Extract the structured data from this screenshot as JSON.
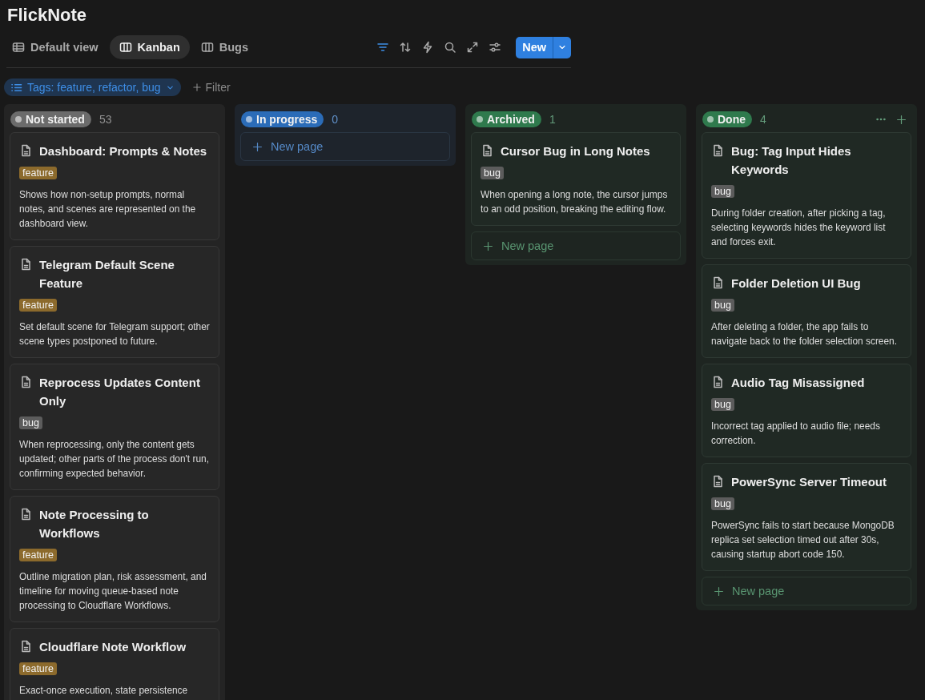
{
  "app_title": "FlickNote",
  "tabs": [
    {
      "label": "Default view",
      "kind": "table",
      "selected": false
    },
    {
      "label": "Kanban",
      "kind": "board",
      "selected": true
    },
    {
      "label": "Bugs",
      "kind": "board",
      "selected": false
    }
  ],
  "toolbar": [
    {
      "kind": "filter",
      "active": true
    },
    {
      "kind": "sort",
      "active": false
    },
    {
      "kind": "bolt",
      "active": false
    },
    {
      "kind": "search",
      "active": false
    },
    {
      "kind": "expand",
      "active": false
    },
    {
      "kind": "settings",
      "active": false
    }
  ],
  "new_button": "New",
  "filters": {
    "chip": "Tags: feature, refactor, bug",
    "add": "Filter"
  },
  "columns": [
    {
      "status": "Not started",
      "count": "53",
      "color": "#6b6b6b",
      "show_actions": false,
      "cards": [
        {
          "title": "Dashboard: Prompts & Notes",
          "tag": {
            "label": "feature",
            "color": "#8c6a2c"
          },
          "description": "Shows how non-setup prompts, normal notes, and scenes are represented on the dashboard view."
        },
        {
          "title": "Telegram Default Scene Feature",
          "tag": {
            "label": "feature",
            "color": "#8c6a2c"
          },
          "description": "Set default scene for Telegram support; other scene types postponed to future."
        },
        {
          "title": "Reprocess Updates Content Only",
          "tag": {
            "label": "bug",
            "color": "#5c5c5c"
          },
          "description": "When reprocessing, only the content gets updated; other parts of the process don't run, confirming expected behavior."
        },
        {
          "title": "Note Processing to Workflows",
          "tag": {
            "label": "feature",
            "color": "#8c6a2c"
          },
          "description": "Outline migration plan, risk assessment, and timeline for moving queue-based note processing to Cloudflare Workflows."
        },
        {
          "title": "Cloudflare Note Workflow",
          "tag": {
            "label": "feature",
            "color": "#8c6a2c"
          },
          "description": "Exact-once execution, state persistence"
        }
      ]
    },
    {
      "status": "In progress",
      "count": "0",
      "color": "#2b6cb8",
      "show_actions": false,
      "new_page": "New page"
    },
    {
      "status": "Archived",
      "count": "1",
      "color": "#2f7a4d",
      "show_actions": false,
      "new_page": "New page",
      "cards": [
        {
          "title": "Cursor Bug in Long Notes",
          "tag": {
            "label": "bug",
            "color": "#5c5c5c"
          },
          "description": "When opening a long note, the cursor jumps to an odd position, breaking the editing flow."
        }
      ]
    },
    {
      "status": "Done",
      "count": "4",
      "color": "#2f7a4d",
      "show_actions": true,
      "new_page": "New page",
      "cards": [
        {
          "title": "Bug: Tag Input Hides Keywords",
          "tag": {
            "label": "bug",
            "color": "#5c5c5c"
          },
          "description": "During folder creation, after picking a tag, selecting keywords hides the keyword list and forces exit."
        },
        {
          "title": "Folder Deletion UI Bug",
          "tag": {
            "label": "bug",
            "color": "#5c5c5c"
          },
          "description": "After deleting a folder, the app fails to navigate back to the folder selection screen."
        },
        {
          "title": "Audio Tag Misassigned",
          "tag": {
            "label": "bug",
            "color": "#5c5c5c"
          },
          "description": "Incorrect tag applied to audio file; needs correction."
        },
        {
          "title": "PowerSync Server Timeout",
          "tag": {
            "label": "bug",
            "color": "#5c5c5c"
          },
          "description": "PowerSync fails to start because MongoDB replica set selection timed out after 30s, causing startup abort code 150."
        }
      ]
    }
  ]
}
